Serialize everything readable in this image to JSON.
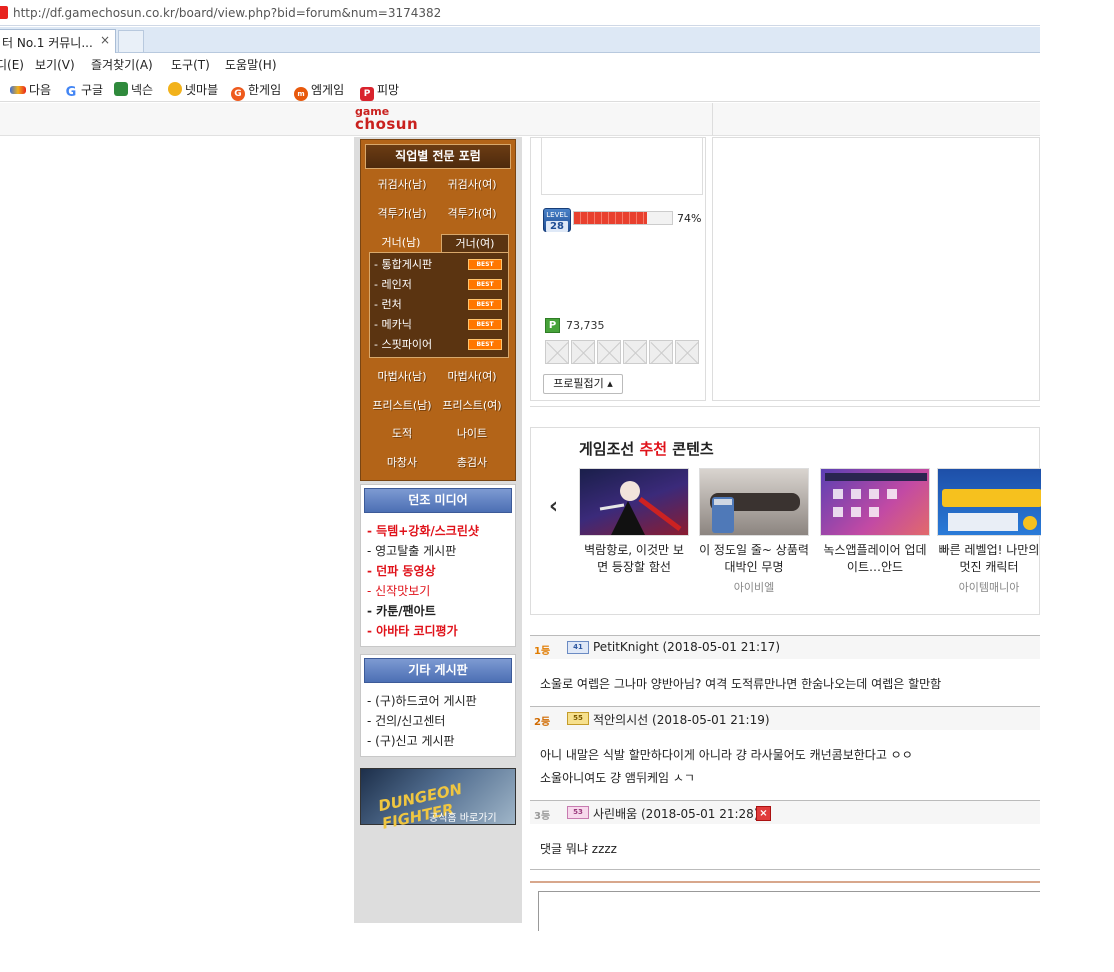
{
  "browser": {
    "url": "http://df.gamechosun.co.kr/board/view.php?bid=forum&num=3174382",
    "tab_title": "터 No.1 커뮤니...",
    "tab_close": "×",
    "menu": [
      "디(E)",
      "보기(V)",
      "즐겨찾기(A)",
      "도구(T)",
      "도움말(H)"
    ],
    "favorites": [
      {
        "label": "다음",
        "icon": "daum-icon",
        "color": "#3d6fd9"
      },
      {
        "label": "구글",
        "icon": "google-icon",
        "color": "#4285f4"
      },
      {
        "label": "넥슨",
        "icon": "nexon-icon",
        "color": "#2f8a3c"
      },
      {
        "label": "넷마블",
        "icon": "netmarble-icon",
        "color": "#f2b21b"
      },
      {
        "label": "한게임",
        "icon": "hangame-icon",
        "color": "#ee5a1d"
      },
      {
        "label": "엠게임",
        "icon": "mgame-icon",
        "color": "#e8590c"
      },
      {
        "label": "피망",
        "icon": "pmang-icon",
        "color": "#d9232d"
      }
    ]
  },
  "site": {
    "logo_top": "game",
    "logo_bottom": "chosun",
    "accent": "#c9211e"
  },
  "sidebar": {
    "job_title": "직업별 전문 포럼",
    "job_rows": [
      [
        "귀검사(남)",
        "귀검사(여)"
      ],
      [
        "격투가(남)",
        "격투가(여)"
      ]
    ],
    "gunner_tabs": [
      "거너(남)",
      "거너(여)"
    ],
    "gunner_items": [
      {
        "label": "- 통합게시판",
        "badge": "BEST"
      },
      {
        "label": "- 레인저",
        "badge": "BEST"
      },
      {
        "label": "- 런처",
        "badge": "BEST"
      },
      {
        "label": "- 메카닉",
        "badge": "BEST"
      },
      {
        "label": "- 스핏파이어",
        "badge": "BEST"
      }
    ],
    "job_rows_bottom": [
      [
        "마법사(남)",
        "마법사(여)"
      ],
      [
        "프리스트(남)",
        "프리스트(여)"
      ],
      [
        "도적",
        "나이트"
      ],
      [
        "마창사",
        "총검사"
      ]
    ],
    "media_title": "던조 미디어",
    "media_items": [
      {
        "label": "- 득템+강화/스크린샷",
        "style": "red"
      },
      {
        "label": "- 영고탈출 게시판",
        "style": "blk"
      },
      {
        "label": "- 던파 동영상",
        "style": "red"
      },
      {
        "label": "- 신작맛보기",
        "style": "redn"
      },
      {
        "label": "- 카툰/팬아트",
        "style": "blkbold"
      },
      {
        "label": "- 아바타 코디평가",
        "style": "red"
      }
    ],
    "etc_title": "기타 게시판",
    "etc_items": [
      "- (구)하드코어 게시판",
      "- 건의/신고센터",
      "- (구)신고 게시판"
    ],
    "banner_logo": "DUNGEON FIGHTER",
    "banner_sub": "공식홈 바로가기"
  },
  "profile": {
    "level_label": "LEVEL",
    "level": "28",
    "level_progress": 0.74,
    "level_pct": "74%",
    "points": "73,735",
    "point_icon": "P",
    "fold_button": "프로필접기 ▴"
  },
  "game_contents": {
    "title_pre": "게임조선 ",
    "title_accent": "추천",
    "title_post": " 콘텐츠",
    "prev": "‹",
    "cards": [
      {
        "caption": "벽람항로, 이것만 보면 등장할 함선",
        "source": ""
      },
      {
        "caption": "이 정도일 줄~ 상품력 대박인 무명",
        "source": "아이비엘"
      },
      {
        "caption": "녹스앱플레이어 업데이트…안드",
        "source": ""
      },
      {
        "caption": "빠른 레벨업! 나만의 멋진 캐릭터",
        "source": "아이템매니아"
      }
    ]
  },
  "comments": [
    {
      "rank": "1등",
      "level": "41",
      "author": "PetitKnight",
      "time": "(2018-05-01 21:17)",
      "lines": [
        "소울로 여렙은 그나마 양반아님? 여격 도적류만나면 한숨나오는데 여렙은 할만함"
      ]
    },
    {
      "rank": "2등",
      "level": "55",
      "author": "적안의시선",
      "time": "(2018-05-01 21:19)",
      "lines": [
        "아니 내말은 식발 할만하다이게 아니라 걍 라사물어도 캐넌콤보한다고 ㅇㅇ",
        "소울아니여도 걍 앰뒤케임 ㅅㄱ"
      ]
    },
    {
      "rank": "3등",
      "level": "53",
      "author": "사린배움",
      "time": "(2018-05-01 21:28)",
      "lines": [
        "댓글 뭐냐 zzzz"
      ],
      "deletable": true
    }
  ]
}
